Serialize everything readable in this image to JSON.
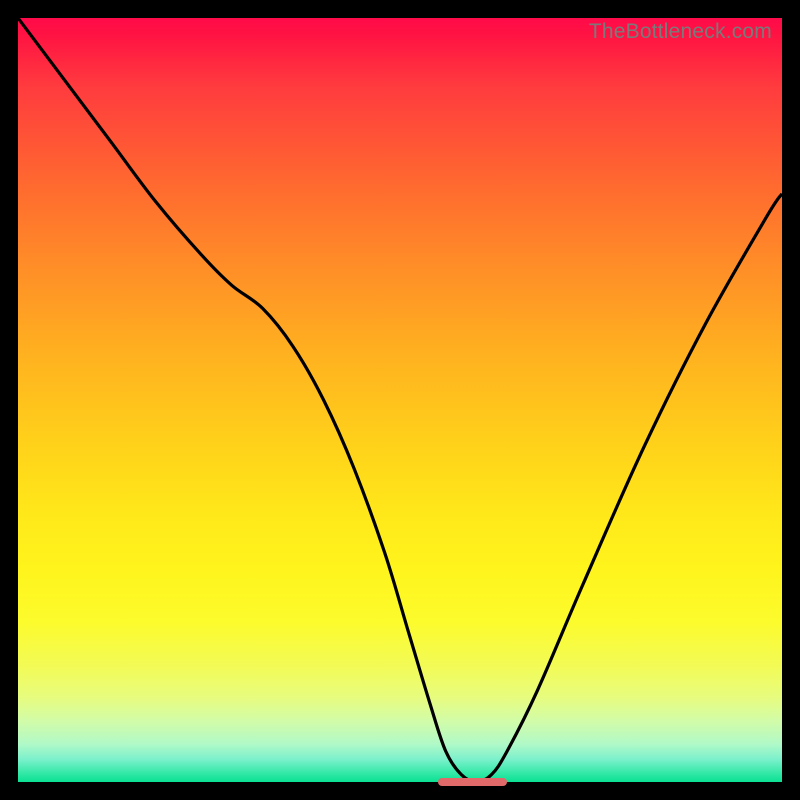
{
  "watermark": "TheBottleneck.com",
  "colors": {
    "curve": "#000000",
    "optimum_marker": "#e0696a",
    "frame": "#000000"
  },
  "chart_data": {
    "type": "line",
    "title": "",
    "xlabel": "",
    "ylabel": "",
    "xlim": [
      0,
      100
    ],
    "ylim": [
      0,
      100
    ],
    "grid": false,
    "legend": false,
    "series": [
      {
        "name": "bottleneck-curve",
        "x": [
          0,
          6,
          12,
          18,
          24,
          28,
          32,
          36,
          40,
          44,
          48,
          51,
          54,
          56,
          58,
          60,
          62,
          64,
          68,
          74,
          82,
          90,
          98,
          100
        ],
        "y": [
          100,
          92,
          84,
          76,
          69,
          65,
          62,
          57,
          50,
          41,
          30,
          20,
          10,
          4,
          1,
          0,
          1,
          4,
          12,
          26,
          44,
          60,
          74,
          77
        ]
      }
    ],
    "optimum_marker": {
      "x_start": 55,
      "x_end": 64,
      "y": 0
    }
  }
}
